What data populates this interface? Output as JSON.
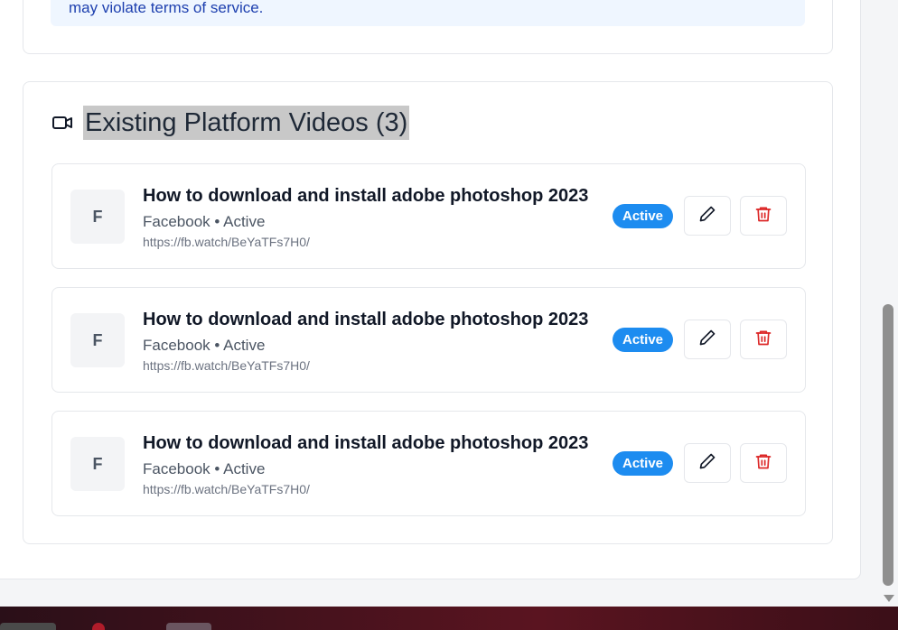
{
  "notice": {
    "text": "may violate terms of service."
  },
  "section": {
    "title": "Existing Platform Videos (3)",
    "icon": "video-camera-icon"
  },
  "videos": [
    {
      "avatar": "F",
      "title": "How to download and install adobe photoshop 2023",
      "meta": "Facebook • Active",
      "url": "https://fb.watch/BeYaTFs7H0/",
      "status": "Active"
    },
    {
      "avatar": "F",
      "title": "How to download and install adobe photoshop 2023",
      "meta": "Facebook • Active",
      "url": "https://fb.watch/BeYaTFs7H0/",
      "status": "Active"
    },
    {
      "avatar": "F",
      "title": "How to download and install adobe photoshop 2023",
      "meta": "Facebook • Active",
      "url": "https://fb.watch/BeYaTFs7H0/",
      "status": "Active"
    }
  ],
  "icons": {
    "edit": "pencil-icon",
    "delete": "trash-icon"
  },
  "colors": {
    "accent": "#1d8cf0",
    "danger": "#dc2626",
    "notice_bg": "#eff6ff",
    "notice_text": "#1e40af"
  }
}
